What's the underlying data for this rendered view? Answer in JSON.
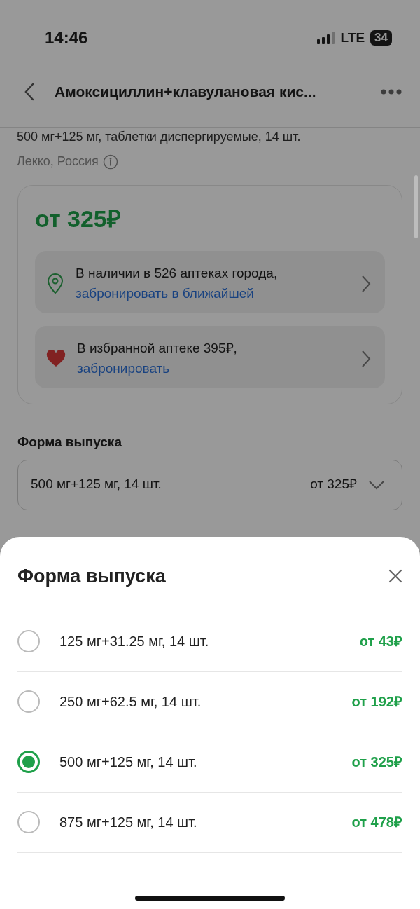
{
  "status_bar": {
    "time": "14:46",
    "network": "LTE",
    "battery": "34"
  },
  "header": {
    "title": "Амоксициллин+клавулановая кис..."
  },
  "product": {
    "dosage": "500 мг+125 мг, таблетки диспергируемые, 14 шт.",
    "maker": "Лекко, Россия",
    "price": "от 325₽",
    "offers": [
      {
        "kind": "nearby",
        "text": "В наличии в 526 аптеках города,",
        "link": "забронировать в ближайшей"
      },
      {
        "kind": "favorite",
        "text": "В избранной аптеке 395₽,",
        "link": "забронировать"
      }
    ]
  },
  "form_select": {
    "label": "Форма выпуска",
    "value": "500 мг+125 мг, 14 шт.",
    "price": "от 325₽"
  },
  "sheet": {
    "title": "Форма выпуска",
    "options": [
      {
        "label": "125 мг+31.25 мг, 14 шт.",
        "price": "от 43₽",
        "selected": false
      },
      {
        "label": "250 мг+62.5 мг, 14 шт.",
        "price": "от 192₽",
        "selected": false
      },
      {
        "label": "500 мг+125 мг, 14 шт.",
        "price": "от 325₽",
        "selected": true
      },
      {
        "label": "875 мг+125 мг, 14 шт.",
        "price": "от 478₽",
        "selected": false
      }
    ]
  }
}
